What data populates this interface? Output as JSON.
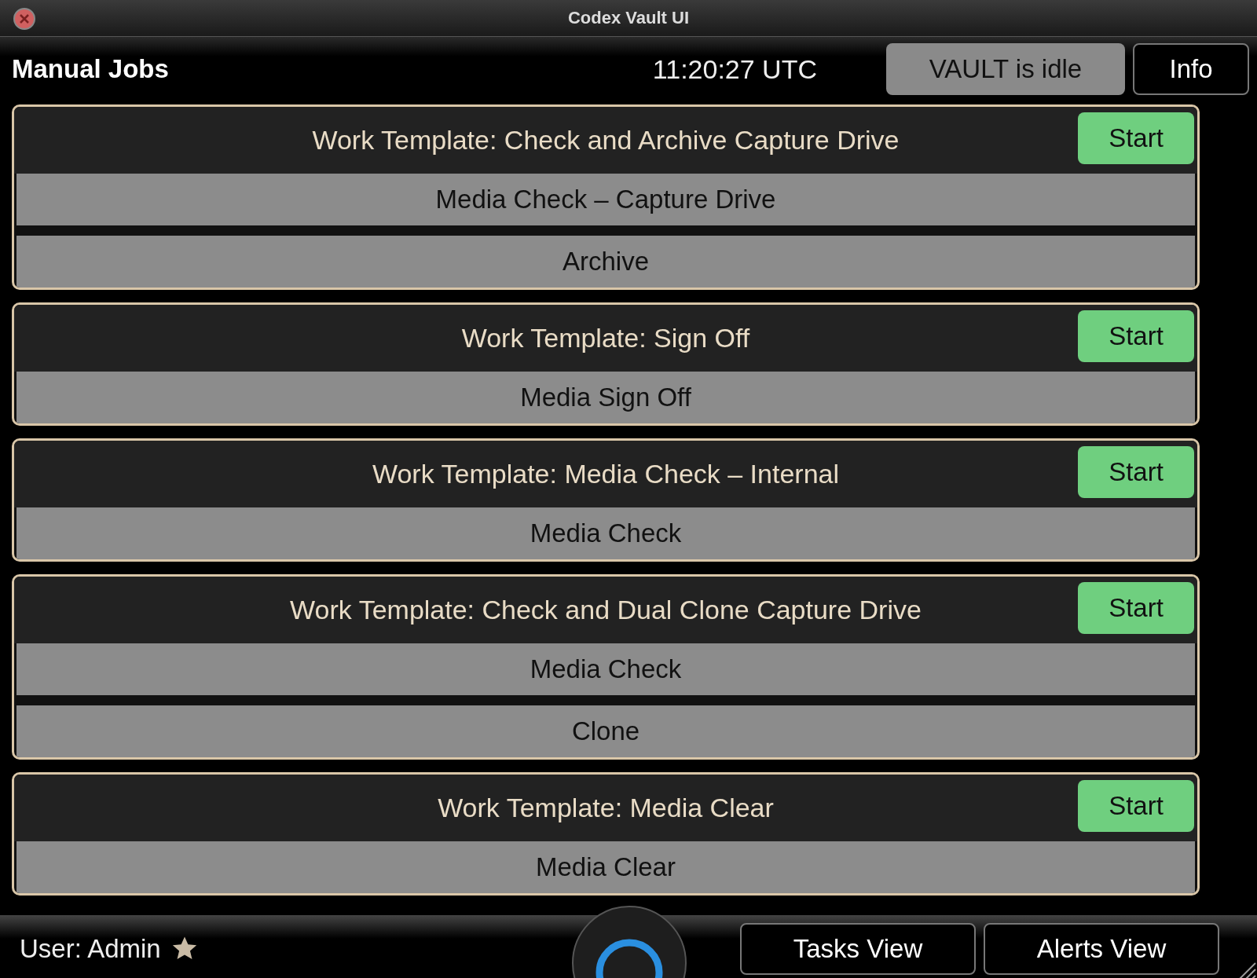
{
  "window": {
    "title": "Codex Vault UI"
  },
  "header": {
    "title": "Manual Jobs",
    "clock": "11:20:27 UTC",
    "status": "VAULT is idle",
    "info_button": "Info"
  },
  "templates": [
    {
      "title": "Work Template: Check and Archive Capture Drive",
      "button": "Start",
      "steps": [
        "Media Check – Capture Drive",
        "Archive"
      ]
    },
    {
      "title": "Work Template: Sign Off",
      "button": "Start",
      "steps": [
        "Media Sign Off"
      ]
    },
    {
      "title": "Work Template: Media Check – Internal",
      "button": "Start",
      "steps": [
        "Media Check"
      ]
    },
    {
      "title": "Work Template: Check and Dual Clone Capture Drive",
      "button": "Start",
      "steps": [
        "Media Check",
        "Clone"
      ]
    },
    {
      "title": "Work Template: Media Clear",
      "button": "Start",
      "steps": [
        "Media Clear"
      ]
    }
  ],
  "footer": {
    "user": "User: Admin",
    "buttons": [
      "Tasks View",
      "Alerts View"
    ]
  }
}
